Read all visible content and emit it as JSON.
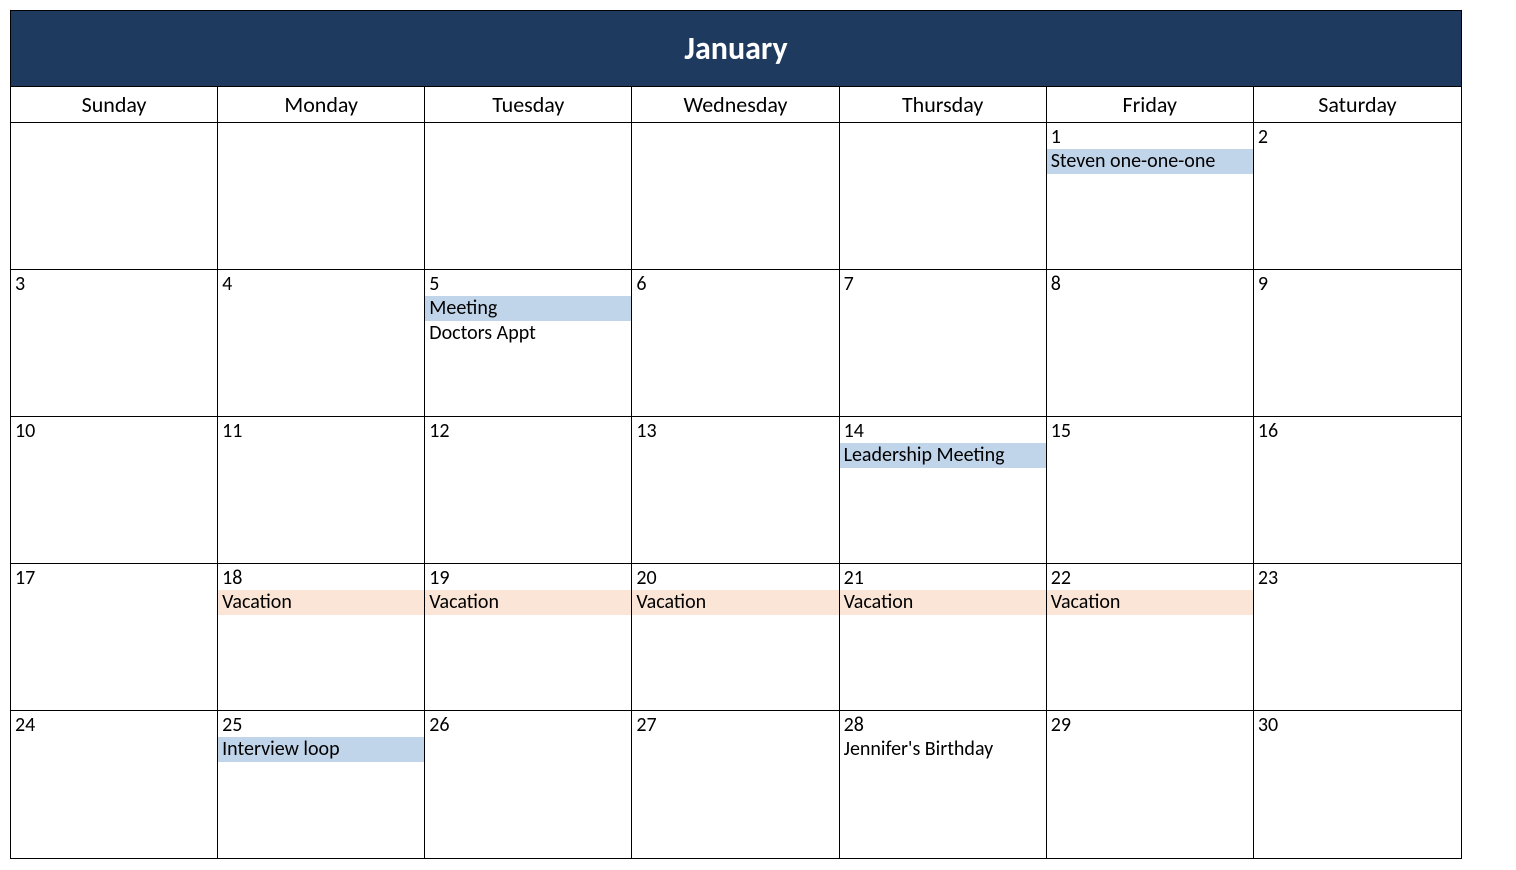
{
  "month_title": "January",
  "weekdays": [
    "Sunday",
    "Monday",
    "Tuesday",
    "Wednesday",
    "Thursday",
    "Friday",
    "Saturday"
  ],
  "colors": {
    "header_bg": "#1f3a5f",
    "event_blue": "#c1d5ea",
    "event_orange": "#fbe5d6"
  },
  "weeks": [
    [
      {
        "day": "",
        "events": []
      },
      {
        "day": "",
        "events": []
      },
      {
        "day": "",
        "events": []
      },
      {
        "day": "",
        "events": []
      },
      {
        "day": "",
        "events": []
      },
      {
        "day": "1",
        "events": [
          {
            "label": "Steven one-one-one",
            "color": "blue"
          }
        ]
      },
      {
        "day": "2",
        "events": []
      }
    ],
    [
      {
        "day": "3",
        "events": []
      },
      {
        "day": "4",
        "events": []
      },
      {
        "day": "5",
        "events": [
          {
            "label": "Meeting",
            "color": "blue"
          },
          {
            "label": "Doctors Appt",
            "color": "plain"
          }
        ]
      },
      {
        "day": "6",
        "events": []
      },
      {
        "day": "7",
        "events": []
      },
      {
        "day": "8",
        "events": []
      },
      {
        "day": "9",
        "events": []
      }
    ],
    [
      {
        "day": "10",
        "events": []
      },
      {
        "day": "11",
        "events": []
      },
      {
        "day": "12",
        "events": []
      },
      {
        "day": "13",
        "events": []
      },
      {
        "day": "14",
        "events": [
          {
            "label": "Leadership Meeting",
            "color": "blue"
          }
        ]
      },
      {
        "day": "15",
        "events": []
      },
      {
        "day": "16",
        "events": []
      }
    ],
    [
      {
        "day": "17",
        "events": []
      },
      {
        "day": "18",
        "events": [
          {
            "label": "Vacation",
            "color": "orange"
          }
        ]
      },
      {
        "day": "19",
        "events": [
          {
            "label": "Vacation",
            "color": "orange"
          }
        ]
      },
      {
        "day": "20",
        "events": [
          {
            "label": "Vacation",
            "color": "orange"
          }
        ]
      },
      {
        "day": "21",
        "events": [
          {
            "label": "Vacation",
            "color": "orange"
          }
        ]
      },
      {
        "day": "22",
        "events": [
          {
            "label": "Vacation",
            "color": "orange"
          }
        ]
      },
      {
        "day": "23",
        "events": []
      }
    ],
    [
      {
        "day": "24",
        "events": []
      },
      {
        "day": "25",
        "events": [
          {
            "label": "Interview loop",
            "color": "blue"
          }
        ]
      },
      {
        "day": "26",
        "events": []
      },
      {
        "day": "27",
        "events": []
      },
      {
        "day": "28",
        "events": [
          {
            "label": "Jennifer's Birthday",
            "color": "plain"
          }
        ]
      },
      {
        "day": "29",
        "events": []
      },
      {
        "day": "30",
        "events": []
      }
    ]
  ]
}
